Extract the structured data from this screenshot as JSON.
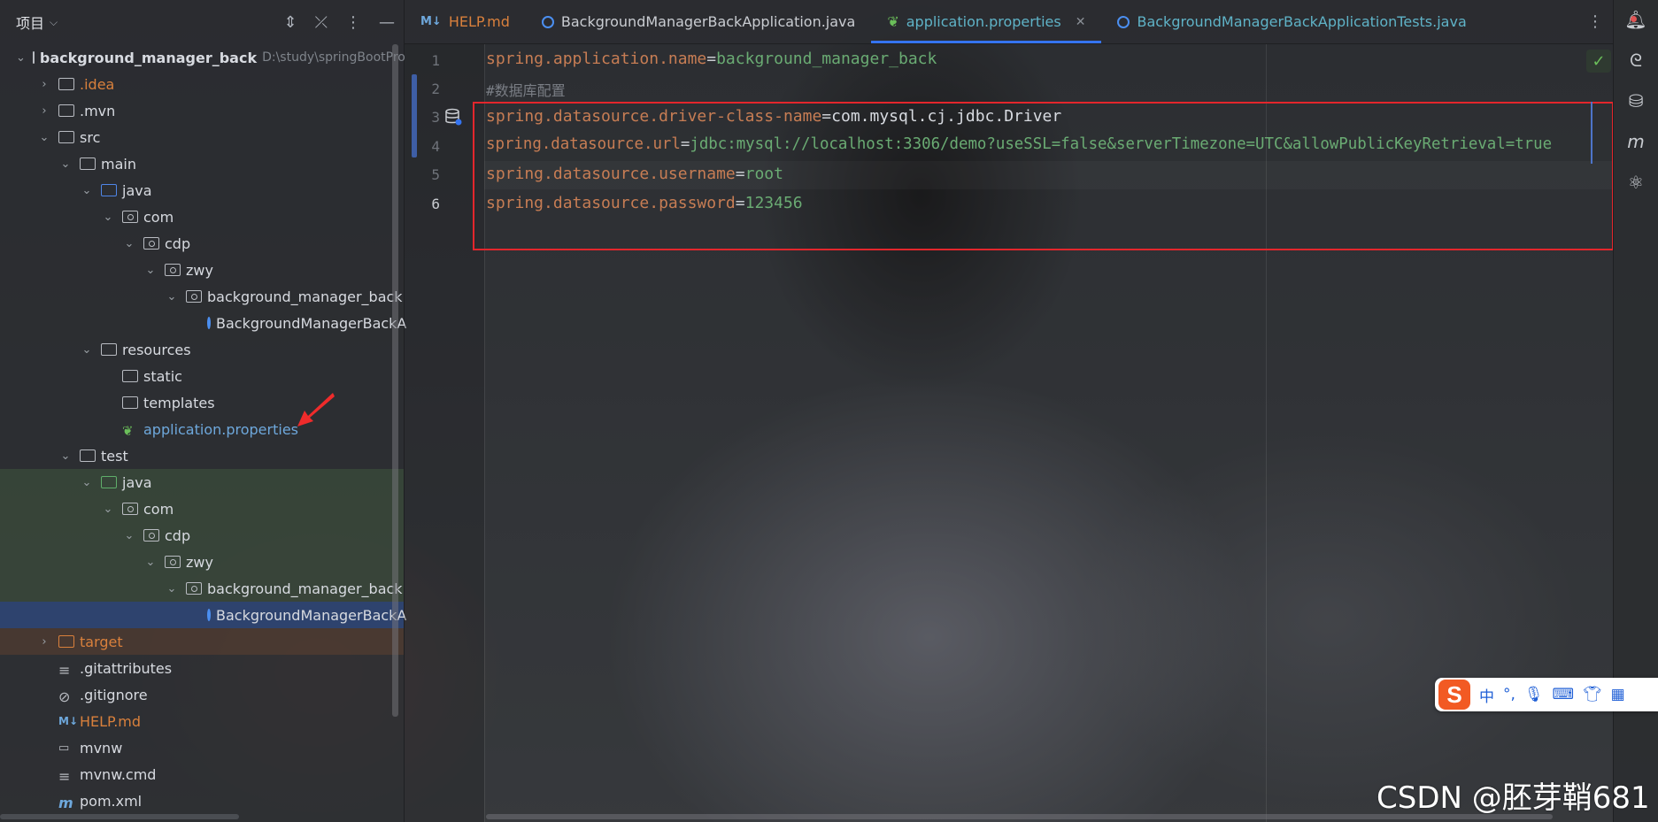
{
  "project": {
    "title": "项目",
    "tree": [
      {
        "label": "background_manager_back",
        "path": "D:\\study\\springBootPro"
      },
      {
        "label": ".idea"
      },
      {
        "label": ".mvn"
      },
      {
        "label": "src"
      },
      {
        "label": "main"
      },
      {
        "label": "java"
      },
      {
        "label": "com"
      },
      {
        "label": "cdp"
      },
      {
        "label": "zwy"
      },
      {
        "label": "background_manager_back"
      },
      {
        "label": "BackgroundManagerBackA"
      },
      {
        "label": "resources"
      },
      {
        "label": "static"
      },
      {
        "label": "templates"
      },
      {
        "label": "application.properties"
      },
      {
        "label": "test"
      },
      {
        "label": "java"
      },
      {
        "label": "com"
      },
      {
        "label": "cdp"
      },
      {
        "label": "zwy"
      },
      {
        "label": "background_manager_back"
      },
      {
        "label": "BackgroundManagerBackA"
      },
      {
        "label": "target"
      },
      {
        "label": ".gitattributes"
      },
      {
        "label": ".gitignore"
      },
      {
        "label": "HELP.md"
      },
      {
        "label": "mvnw"
      },
      {
        "label": "mvnw.cmd"
      },
      {
        "label": "pom.xml"
      }
    ]
  },
  "tabs": [
    {
      "label": "HELP.md",
      "icon": "M↓"
    },
    {
      "label": "BackgroundManagerBackApplication.java"
    },
    {
      "label": "application.properties",
      "active": true
    },
    {
      "label": "BackgroundManagerBackApplicationTests.java"
    }
  ],
  "editor": {
    "lines": [
      {
        "num": "1",
        "key": "spring.application.name",
        "value": "background_manager_back"
      },
      {
        "num": "2",
        "comment": "#数据库配置"
      },
      {
        "num": "3",
        "key": "spring.datasource.driver-class-name",
        "value": "com.mysql.cj.jdbc.Driver"
      },
      {
        "num": "4",
        "key": "spring.datasource.url",
        "value": "jdbc:mysql://localhost:3306/demo?useSSL=false&serverTimezone=UTC&allowPublicKeyRetrieval=true"
      },
      {
        "num": "5",
        "key": "spring.datasource.username",
        "value": "root"
      },
      {
        "num": "6",
        "key": "spring.datasource.password",
        "value": "123456"
      }
    ],
    "eq": "="
  },
  "ime": {
    "logo": "S",
    "lang": "中",
    "punct": "°,"
  },
  "watermark": "CSDN @胚芽鞘681",
  "colors": {
    "accent": "#3574f0",
    "highlight_box": "#e3262c",
    "key": "#c77d54",
    "value": "#6aab73"
  }
}
